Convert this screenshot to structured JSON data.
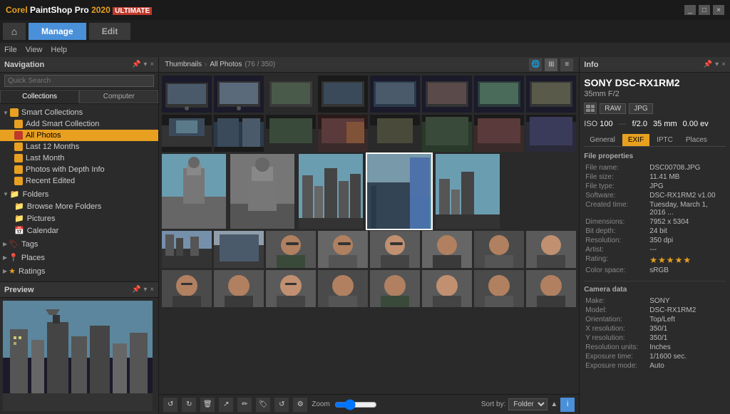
{
  "titlebar": {
    "logo": "Corel PaintShop Pro",
    "year": "2020",
    "ultimate": "ULTIMATE",
    "winbtns": [
      "_",
      "□",
      "×"
    ]
  },
  "navbar": {
    "home_label": "⌂",
    "tabs": [
      {
        "label": "Manage",
        "active": true
      },
      {
        "label": "Edit",
        "active": false
      }
    ]
  },
  "menubar": {
    "items": [
      "File",
      "View",
      "Help"
    ]
  },
  "left_panel": {
    "navigation_title": "Navigation",
    "quick_search_placeholder": "Quick Search",
    "collection_tabs": [
      "Collections",
      "Computer"
    ],
    "smart_collections_label": "Smart Collections",
    "tree_items": [
      {
        "label": "Add Smart Collection",
        "icon": "orange",
        "level": 2
      },
      {
        "label": "All Photos",
        "icon": "red",
        "active": true,
        "level": 2
      },
      {
        "label": "Last 12 Months",
        "icon": "orange",
        "level": 2
      },
      {
        "label": "Last Month",
        "icon": "orange",
        "level": 2
      },
      {
        "label": "Photos with Depth Info",
        "icon": "orange",
        "level": 2
      },
      {
        "label": "Recent Edited",
        "icon": "orange",
        "level": 2
      }
    ],
    "folders_label": "Folders",
    "folder_items": [
      {
        "label": "Browse More Folders",
        "icon": "folder-blue",
        "level": 2
      },
      {
        "label": "Pictures",
        "icon": "folder-yellow",
        "level": 2
      },
      {
        "label": "Calendar",
        "icon": "calendar",
        "level": 1
      }
    ],
    "tags_label": "Tags",
    "places_label": "Places",
    "ratings_label": "Ratings"
  },
  "preview_panel": {
    "title": "Preview"
  },
  "thumbnails": {
    "breadcrumb_root": "Thumbnails",
    "breadcrumb_sep": "›",
    "breadcrumb_folder": "All Photos",
    "count": "(76 / 350)",
    "photo_count_label": "76 / 350",
    "sort_by_label": "Sort by:",
    "sort_by_value": "Folder",
    "zoom_label": "Zoom"
  },
  "info_panel": {
    "title": "Info",
    "camera_model": "SONY DSC-RX1RM2",
    "lens_info": "35mm F/2",
    "format_label": "JPG",
    "iso_label": "ISO",
    "iso_value": "100",
    "aperture_value": "f/2.0",
    "focal_length": "35 mm",
    "exposure_val": "0.00 ev",
    "tabs": [
      "General",
      "EXIF",
      "IPTC",
      "Places"
    ],
    "active_tab": "EXIF",
    "file_properties_title": "File properties",
    "file_name_label": "File name:",
    "file_name_value": "DSC00708.JPG",
    "file_size_label": "File size:",
    "file_size_value": "11.41 MB",
    "file_type_label": "File type:",
    "file_type_value": "JPG",
    "software_label": "Software:",
    "software_value": "DSC-RX1RM2 v1.00",
    "created_label": "Created time:",
    "created_value": "Tuesday, March 1, 2016 ...",
    "dimensions_label": "Dimensions:",
    "dimensions_value": "7952 x 5304",
    "bit_depth_label": "Bit depth:",
    "bit_depth_value": "24 bit",
    "resolution_label": "Resolution:",
    "resolution_value": "350 dpi",
    "artist_label": "Artist:",
    "artist_value": "---",
    "rating_label": "Rating:",
    "rating_value": 5,
    "color_space_label": "Color space:",
    "color_space_value": "sRGB",
    "camera_data_title": "Camera data",
    "make_label": "Make:",
    "make_value": "SONY",
    "model_label": "Model:",
    "model_value": "DSC-RX1RM2",
    "orientation_label": "Orientation:",
    "orientation_value": "Top/Left",
    "x_res_label": "X resolution:",
    "x_res_value": "350/1",
    "y_res_label": "Y resolution:",
    "y_res_value": "350/1",
    "res_units_label": "Resolution units:",
    "res_units_value": "Inches",
    "exp_time_label": "Exposure time:",
    "exp_time_value": "1/1600 sec.",
    "exp_mode_label": "Exposure mode:",
    "exp_mode_value": "Auto"
  },
  "thumbnail_rows": [
    {
      "count": 8,
      "selected": -1,
      "type": "desk"
    },
    {
      "count": 8,
      "selected": -1,
      "type": "desk"
    },
    {
      "count": 5,
      "selected": 3,
      "type": "city"
    },
    {
      "count": 8,
      "selected": 3,
      "type": "mixed"
    },
    {
      "count": 8,
      "selected": -1,
      "type": "portrait"
    }
  ]
}
